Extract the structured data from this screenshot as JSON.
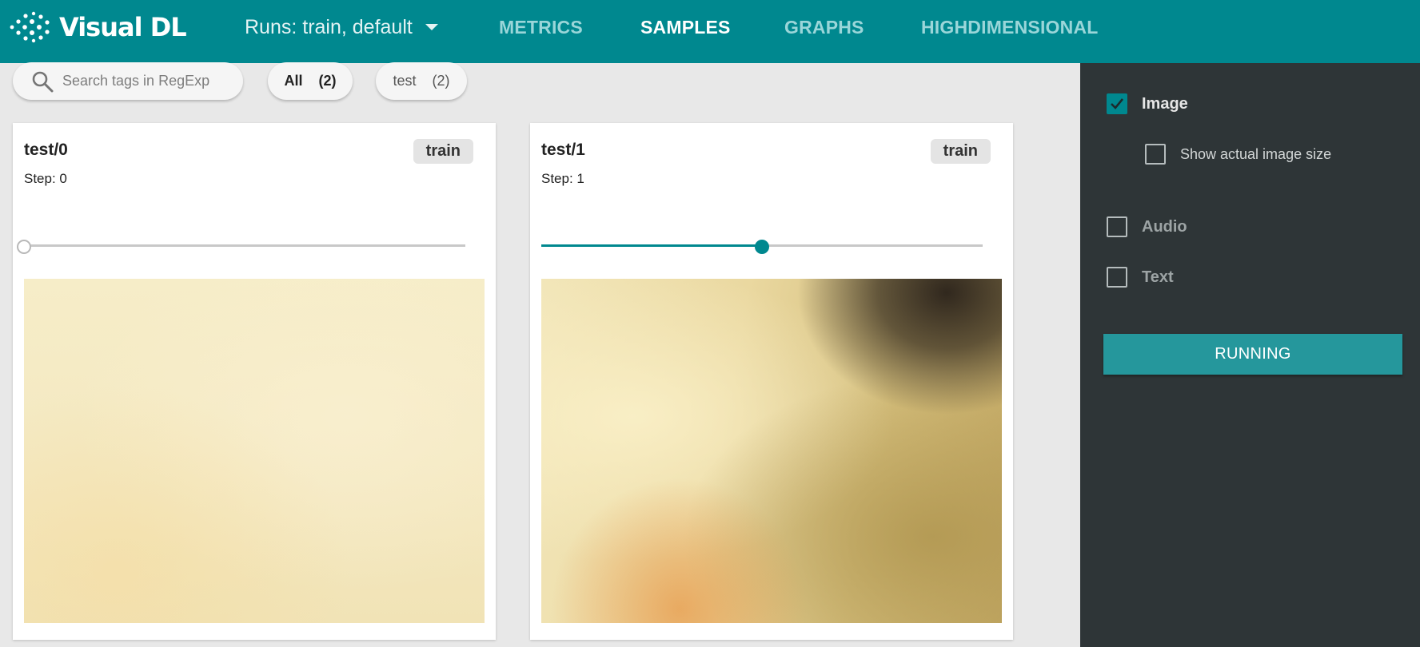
{
  "app": {
    "logo_text": "Visual DL",
    "logo_icon": "dot-grid-logo-icon"
  },
  "header": {
    "runs_label": "Runs: train, default",
    "nav": [
      {
        "label": "METRICS",
        "active": false
      },
      {
        "label": "SAMPLES",
        "active": true
      },
      {
        "label": "GRAPHS",
        "active": false
      },
      {
        "label": "HIGHDIMENSIONAL",
        "active": false
      }
    ]
  },
  "filter": {
    "search_placeholder": "Search tags in RegExp",
    "chips": [
      {
        "label": "All",
        "count": "(2)",
        "active": true
      },
      {
        "label": "test",
        "count": "(2)",
        "active": false
      }
    ]
  },
  "cards": [
    {
      "title": "test/0",
      "run": "train",
      "step_label": "Step: 0",
      "slider_fraction": 0.0
    },
    {
      "title": "test/1",
      "run": "train",
      "step_label": "Step: 1",
      "slider_fraction": 0.5
    }
  ],
  "sidebar": {
    "options": [
      {
        "label": "Image",
        "checked": true
      },
      {
        "label": "Show actual image size",
        "checked": false
      },
      {
        "label": "Audio",
        "checked": false
      },
      {
        "label": "Text",
        "checked": false
      }
    ],
    "running_label": "RUNNING"
  },
  "colors": {
    "brand": "#00888f",
    "sidebar_bg": "#2e3537",
    "button": "#25979c"
  }
}
